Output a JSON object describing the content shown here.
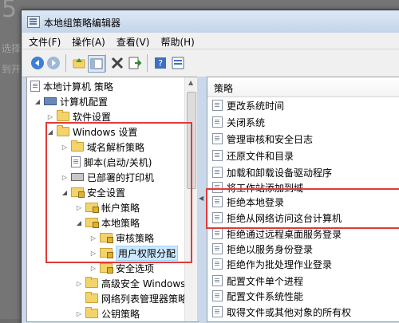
{
  "background": {
    "digit": "5",
    "line1": "选择",
    "line2": "到开"
  },
  "window": {
    "title": "本地组策略编辑器"
  },
  "menu": [
    "文件(F)",
    "操作(A)",
    "查看(V)",
    "帮助(H)"
  ],
  "toolbar": [
    "back-arrow-icon",
    "forward-arrow-icon",
    "up-folder-icon",
    "show-hide-tree-icon",
    "delete-icon",
    "export-list-icon",
    "help-icon",
    "properties-icon"
  ],
  "tree": [
    {
      "label": "本地计算机 策略",
      "arrow": "",
      "icon": "doc"
    },
    {
      "label": "计算机配置",
      "arrow": "◢",
      "icon": "pc"
    },
    {
      "label": "软件设置",
      "arrow": "▷",
      "icon": "folder"
    },
    {
      "label": "Windows 设置",
      "arrow": "◢",
      "icon": "folder"
    },
    {
      "label": "域名解析策略",
      "arrow": "▷",
      "icon": "folder"
    },
    {
      "label": "脚本(启动/关机)",
      "arrow": "",
      "icon": "doc"
    },
    {
      "label": "已部署的打印机",
      "arrow": "▷",
      "icon": "printer"
    },
    {
      "label": "安全设置",
      "arrow": "◢",
      "icon": "lockfolder"
    },
    {
      "label": "帐户策略",
      "arrow": "▷",
      "icon": "lockfolder"
    },
    {
      "label": "本地策略",
      "arrow": "◢",
      "icon": "lockfolder"
    },
    {
      "label": "审核策略",
      "arrow": "▷",
      "icon": "lockfolder"
    },
    {
      "label": "用户权限分配",
      "arrow": "▷",
      "icon": "lockfolder",
      "selected": true
    },
    {
      "label": "安全选项",
      "arrow": "▷",
      "icon": "lockfolder"
    },
    {
      "label": "高级安全 Windows 防",
      "arrow": "▷",
      "icon": "folder"
    },
    {
      "label": "网络列表管理器策略",
      "arrow": "",
      "icon": "folder"
    },
    {
      "label": "公钥策略",
      "arrow": "▷",
      "icon": "folder"
    }
  ],
  "policies": {
    "header": "策略",
    "items": [
      "更改系统时间",
      "关闭系统",
      "管理审核和安全日志",
      "还原文件和目录",
      "加载和卸载设备驱动程序",
      "将工作站添加到域",
      "拒绝本地登录",
      "拒绝从网络访问这台计算机",
      "拒绝通过远程桌面服务登录",
      "拒绝以服务身份登录",
      "拒绝作为批处理作业登录",
      "配置文件单个进程",
      "配置文件系统性能",
      "取得文件或其他对象的所有权"
    ]
  },
  "colors": {
    "highlight_box": "#e23a3a",
    "selection": "#cde8ff"
  }
}
